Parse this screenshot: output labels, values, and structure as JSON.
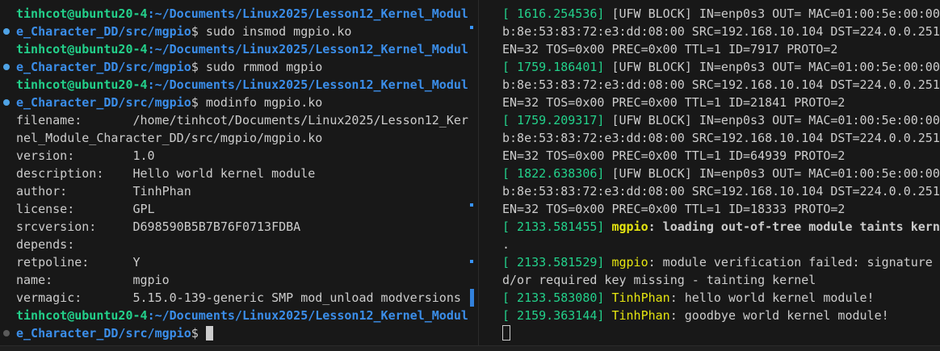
{
  "left": {
    "prompt_user": "tinhcot@ubuntu20-4",
    "path_a": ":~/Documents/Linux2025/Lesson12_Kernel_Modul",
    "path_b": "e_Character_DD/src/mgpio",
    "cmd1": "sudo insmod mgpio.ko",
    "cmd2": "sudo rmmod mgpio",
    "cmd3": "modinfo mgpio.ko",
    "info": [
      "filename:       /home/tinhcot/Documents/Linux2025/Lesson12_Ker",
      "nel_Module_Character_DD/src/mgpio/mgpio.ko",
      "version:        1.0",
      "description:    Hello world kernel module",
      "author:         TinhPhan",
      "license:        GPL",
      "srcversion:     D698590B5B7B76F0713FDBA",
      "depends:",
      "retpoline:      Y",
      "name:           mgpio",
      "vermagic:       5.15.0-139-generic SMP mod_unload modversions"
    ]
  },
  "right": {
    "ufw": [
      {
        "ts": "[ 1616.254536]",
        "rest": " [UFW BLOCK] IN=enp0s3 OUT= MAC=01:00:5e:00:00",
        "l2": "b:8e:53:83:72:e3:dd:08:00 SRC=192.168.10.104 DST=224.0.0.251",
        "l3": "EN=32 TOS=0x00 PREC=0x00 TTL=1 ID=7917 PROTO=2"
      },
      {
        "ts": "[ 1759.186401]",
        "rest": " [UFW BLOCK] IN=enp0s3 OUT= MAC=01:00:5e:00:00",
        "l2": "b:8e:53:83:72:e3:dd:08:00 SRC=192.168.10.104 DST=224.0.0.251",
        "l3": "EN=32 TOS=0x00 PREC=0x00 TTL=1 ID=21841 PROTO=2"
      },
      {
        "ts": "[ 1759.209317]",
        "rest": " [UFW BLOCK] IN=enp0s3 OUT= MAC=01:00:5e:00:00",
        "l2": "b:8e:53:83:72:e3:dd:08:00 SRC=192.168.10.104 DST=224.0.0.251",
        "l3": "EN=32 TOS=0x00 PREC=0x00 TTL=1 ID=64939 PROTO=2"
      },
      {
        "ts": "[ 1822.638306]",
        "rest": " [UFW BLOCK] IN=enp0s3 OUT= MAC=01:00:5e:00:00",
        "l2": "b:8e:53:83:72:e3:dd:08:00 SRC=192.168.10.104 DST=224.0.0.251",
        "l3": "EN=32 TOS=0x00 PREC=0x00 TTL=1 ID=18333 PROTO=2"
      }
    ],
    "taint_ts": "[ 2133.581455]",
    "taint_mod": "mgpio",
    "taint_msg": ": loading out-of-tree module taints kerne",
    "taint_cont": ".",
    "verify_ts": "[ 2133.581529]",
    "verify_mod": "mgpio",
    "verify_msg": ": module verification failed: signature a",
    "verify_cont": "d/or required key missing - tainting kernel",
    "hello_ts": "[ 2133.583080]",
    "hello_mod": "TinhPhan",
    "hello_msg": ": hello world kernel module!",
    "bye_ts": "[ 2159.363144]",
    "bye_mod": "TinhPhan",
    "bye_msg": ": goodbye world kernel module!"
  },
  "colors": {
    "background": "#181818",
    "prompt_user": "#23d18b",
    "prompt_path": "#3b8eea",
    "module_name": "#e5e510",
    "mark_blue": "#4fa3e6"
  }
}
